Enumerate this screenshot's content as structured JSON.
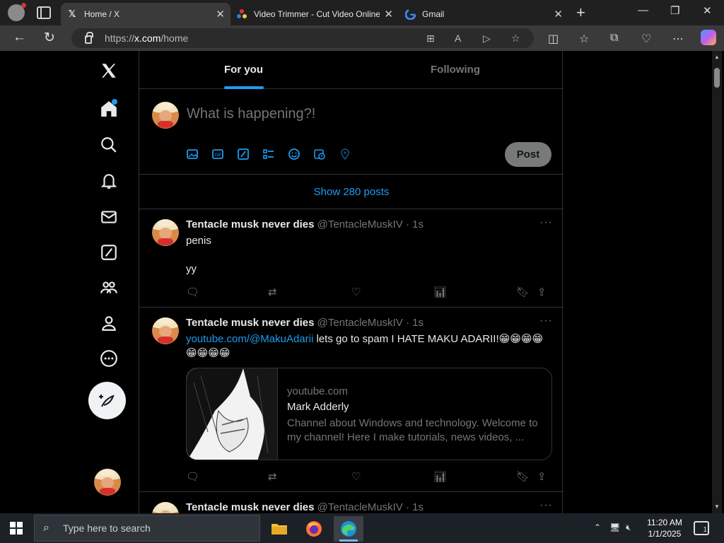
{
  "browser": {
    "tabs": [
      {
        "title": "Home / X",
        "active": true,
        "favicon": "x-logo"
      },
      {
        "title": "Video Trimmer - Cut Video Online",
        "active": false,
        "favicon": "colorful-dots"
      },
      {
        "title": "Gmail",
        "active": false,
        "favicon": "google-g"
      }
    ],
    "url_scheme": "https://",
    "url_host": "x.com",
    "url_path": "/home"
  },
  "x": {
    "tabs": [
      {
        "label": "For you",
        "selected": true
      },
      {
        "label": "Following",
        "selected": false
      }
    ],
    "composer_placeholder": "What is happening?!",
    "post_button": "Post",
    "show_posts": "Show 280 posts",
    "posts": [
      {
        "name": "Tentacle musk never dies",
        "handle": "@TentacleMuskIV",
        "time": "· 1s",
        "line1": "penis",
        "line2": "yy"
      },
      {
        "name": "Tentacle musk never dies",
        "handle": "@TentacleMuskIV",
        "time": "· 1s",
        "link": "youtube.com/@MakuAdarii",
        "text": " lets go to spam I HATE MAKU ADARII!😁😁😁😁😁😁😁😁",
        "card": {
          "domain": "youtube.com",
          "title": "Mark Adderly",
          "description": "Channel about Windows and technology. Welcome to my channel! Here I make tutorials, news videos, ..."
        }
      },
      {
        "name": "Tentacle musk never dies",
        "handle": "@TentacleMuskIV",
        "time": "· 1s"
      }
    ]
  },
  "taskbar": {
    "search_placeholder": "Type here to search",
    "time": "11:20 AM",
    "date": "1/1/2025",
    "notification_count": "1"
  },
  "colors": {
    "accent": "#1d9bf0",
    "background": "#000000",
    "border": "#2f3336",
    "muted": "#71767b"
  }
}
